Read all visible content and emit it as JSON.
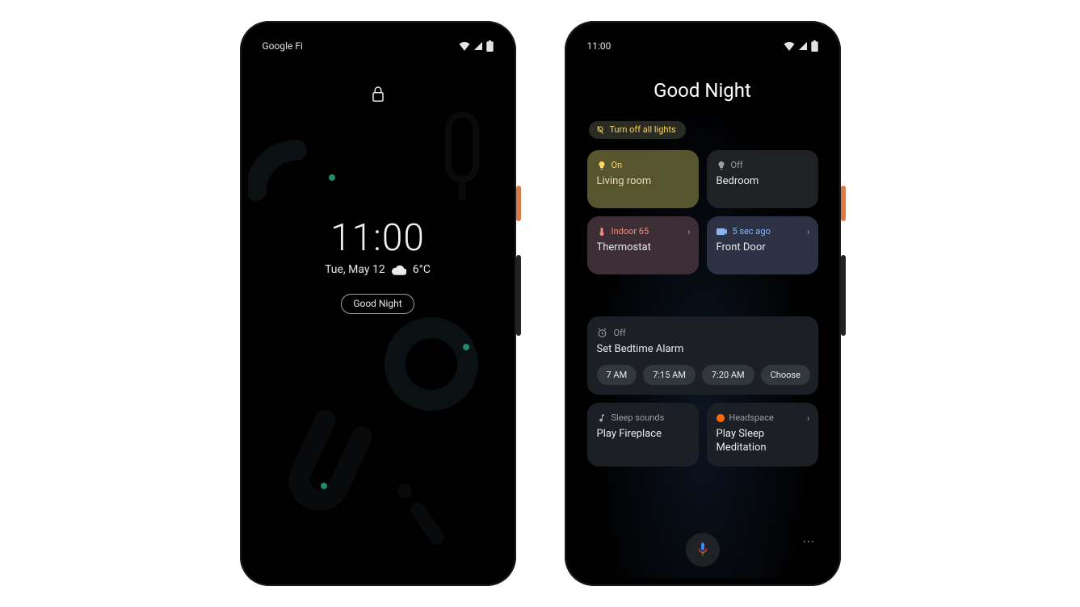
{
  "phone1": {
    "status_left": "Google Fi",
    "clock": "11:00",
    "date": "Tue, May 12",
    "temp": "6°C",
    "chip": "Good Night"
  },
  "phone2": {
    "status_left": "11:00",
    "greeting": "Good Night",
    "turn_off_chip": "Turn off all lights",
    "tiles": {
      "living": {
        "status": "On",
        "name": "Living room"
      },
      "bed": {
        "status": "Off",
        "name": "Bedroom"
      },
      "therm": {
        "status": "Indoor 65",
        "name": "Thermostat"
      },
      "door": {
        "status": "5 sec ago",
        "name": "Front Door"
      }
    },
    "alarm": {
      "status": "Off",
      "title": "Set Bedtime Alarm",
      "options": [
        "7 AM",
        "7:15 AM",
        "7:20 AM",
        "Choose"
      ]
    },
    "sounds": {
      "header": "Sleep sounds",
      "title": "Play Fireplace"
    },
    "headspace": {
      "header": "Headspace",
      "title": "Play Sleep Meditation"
    }
  }
}
